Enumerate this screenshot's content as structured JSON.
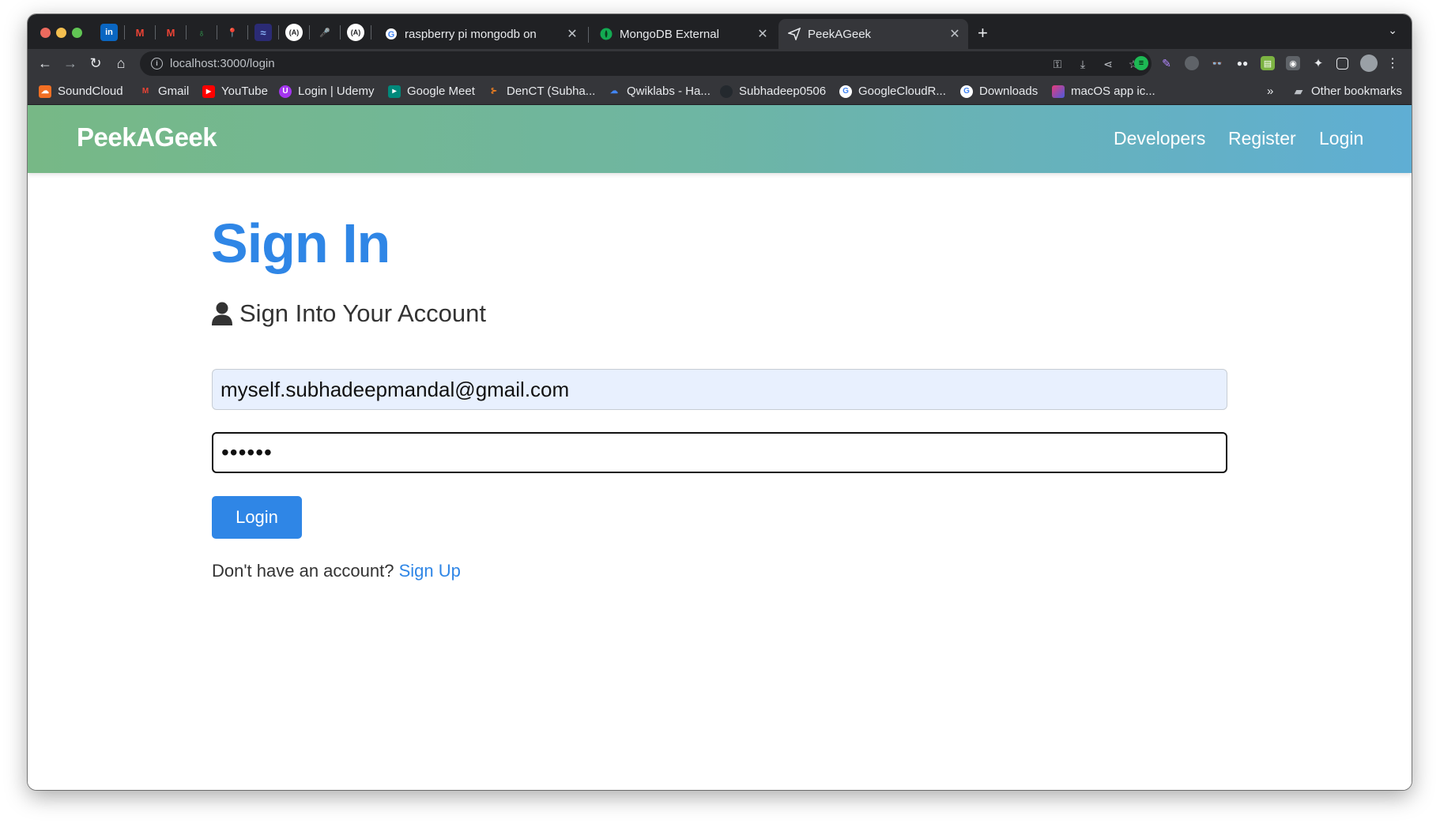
{
  "browser": {
    "tabs": [
      {
        "title": "raspberry pi mongodb on",
        "icon": "google-icon"
      },
      {
        "title": "MongoDB External",
        "icon": "mongodb-leaf-icon"
      },
      {
        "title": "PeekAGeek",
        "icon": "send-arrow-icon",
        "active": true
      }
    ],
    "pinned_tabs": [
      "in",
      "M",
      "M",
      "♁",
      "📍",
      "≈",
      "(A)",
      "🎤",
      "(A)"
    ],
    "new_tab_label": "+",
    "url": "localhost:3000/login",
    "bookmarks": [
      {
        "label": "SoundCloud",
        "color": "#f26f23"
      },
      {
        "label": "Gmail",
        "color": "#ea4335"
      },
      {
        "label": "YouTube",
        "color": "#ff0000"
      },
      {
        "label": "Login | Udemy",
        "color": "#a435f0"
      },
      {
        "label": "Google Meet",
        "color": "#00897b"
      },
      {
        "label": "DenCT (Subha...",
        "color": "#f48120"
      },
      {
        "label": "Qwiklabs - Ha...",
        "color": "#4285f4"
      },
      {
        "label": "Subhadeep0506",
        "color": "#24292e"
      },
      {
        "label": "GoogleCloudR...",
        "color": "#4285f4"
      },
      {
        "label": "Downloads",
        "color": "#4285f4"
      },
      {
        "label": "macOS app ic...",
        "color": "#6a3de8"
      }
    ],
    "bookmarks_overflow": "»",
    "other_bookmarks": "Other bookmarks"
  },
  "navbar": {
    "brand": "PeekAGeek",
    "links": [
      "Developers",
      "Register",
      "Login"
    ]
  },
  "main": {
    "title": "Sign In",
    "lead": "Sign Into Your Account",
    "email_value": "myself.subhadeepmandal@gmail.com",
    "password_value": "••••••",
    "login_button": "Login",
    "signup_prompt": "Don't have an account?",
    "signup_link": "Sign Up"
  },
  "colors": {
    "primary": "#2f86e6",
    "navbar_gradient_start": "#77b886",
    "navbar_gradient_end": "#5faed4"
  }
}
